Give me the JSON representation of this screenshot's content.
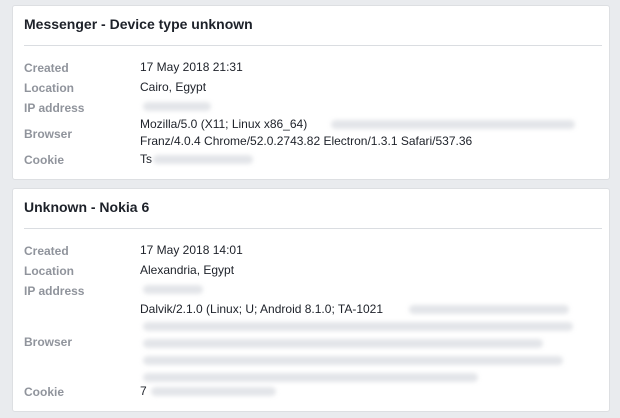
{
  "sessions": [
    {
      "title": "Messenger - Device type unknown",
      "labels": {
        "created": "Created",
        "location": "Location",
        "ip": "IP address",
        "browser": "Browser",
        "cookie": "Cookie"
      },
      "created": "17 May 2018 21:31",
      "location": "Cairo, Egypt",
      "browser_line1": "Mozilla/5.0 (X11; Linux x86_64)",
      "browser_line2": "Franz/4.0.4 Chrome/52.0.2743.82 Electron/1.3.1 Safari/537.36",
      "cookie_prefix": "Ts"
    },
    {
      "title": "Unknown - Nokia 6",
      "labels": {
        "created": "Created",
        "location": "Location",
        "ip": "IP address",
        "browser": "Browser",
        "cookie": "Cookie"
      },
      "created": "17 May 2018 14:01",
      "location": "Alexandria, Egypt",
      "browser_line1": "Dalvik/2.1.0 (Linux; U; Android 8.1.0; TA-1021",
      "cookie_prefix": "7"
    }
  ]
}
